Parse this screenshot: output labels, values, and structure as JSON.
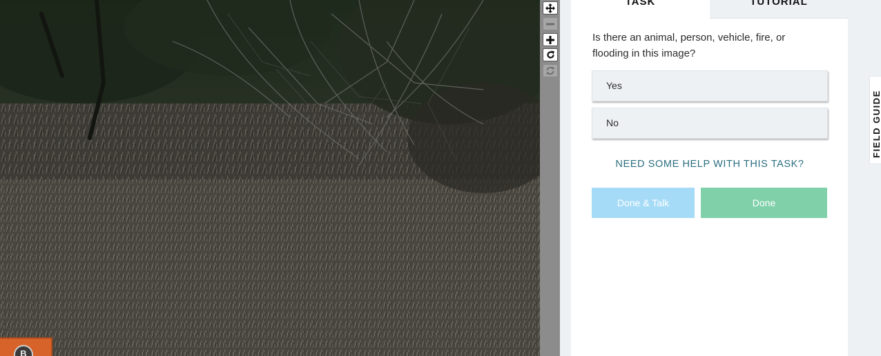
{
  "subject": {
    "watermark_text": "B"
  },
  "toolbar": {
    "buttons": [
      {
        "name": "move-icon",
        "enabled": true
      },
      {
        "name": "zoom-out-icon",
        "enabled": false
      },
      {
        "name": "zoom-in-icon",
        "enabled": true
      },
      {
        "name": "rotate-icon",
        "enabled": true
      },
      {
        "name": "reset-icon",
        "enabled": false
      }
    ]
  },
  "tabs": {
    "task": "TASK",
    "tutorial": "TUTORIAL"
  },
  "task": {
    "question": "Is there an animal, person, vehicle, fire, or flooding in this image?",
    "answers": [
      "Yes",
      "No"
    ],
    "help_link": "NEED SOME HELP WITH THIS TASK?",
    "done_talk": "Done & Talk",
    "done": "Done"
  },
  "field_guide": {
    "label": "FIELD GUIDE"
  },
  "colors": {
    "done_talk": "#a5dbf7",
    "done": "#80d1aa",
    "help_link": "#2b6e7f",
    "toolbar": "#8c8c8c",
    "watermark": "#d8632a"
  }
}
